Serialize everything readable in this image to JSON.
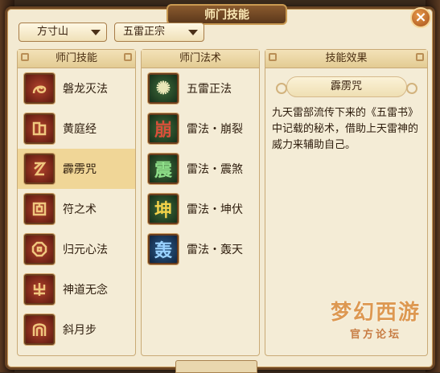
{
  "window": {
    "title": "师门技能",
    "close_label": "×"
  },
  "dropdowns": [
    {
      "value": "方寸山"
    },
    {
      "value": "五雷正宗"
    }
  ],
  "skills_panel": {
    "header": "师门技能",
    "items": [
      {
        "label": "磐龙灭法",
        "icon": "coiled-dragon-glyph"
      },
      {
        "label": "黄庭经",
        "icon": "scroll-book-glyph"
      },
      {
        "label": "霹雳咒",
        "icon": "lightning-glyph"
      },
      {
        "label": "符之术",
        "icon": "talisman-glyph"
      },
      {
        "label": "归元心法",
        "icon": "octagon-heart-glyph"
      },
      {
        "label": "神道无念",
        "icon": "trident-glyph"
      },
      {
        "label": "斜月步",
        "icon": "crescent-step-glyph"
      }
    ],
    "selected_index": 2
  },
  "spells_panel": {
    "header": "师门法术",
    "items": [
      {
        "label": "五雷正法",
        "icon": "thunder-seal-icon",
        "glyph": "✺"
      },
      {
        "label": "雷法・崩裂",
        "icon": "beng-rune-icon",
        "glyph": "崩"
      },
      {
        "label": "雷法・震煞",
        "icon": "zhen-rune-icon",
        "glyph": "震"
      },
      {
        "label": "雷法・坤伏",
        "icon": "kun-rune-icon",
        "glyph": "坤"
      },
      {
        "label": "雷法・轰天",
        "icon": "hong-rune-icon",
        "glyph": "轰"
      }
    ]
  },
  "effect_panel": {
    "header": "技能效果",
    "skill_name": "霹雳咒",
    "description": "九天雷部流传下来的《五雷书》中记载的秘术，借助上天雷神的威力来辅助自己。"
  },
  "watermark": {
    "line1": "梦幻西游",
    "line2": "官方论坛"
  },
  "colors": {
    "frame": "#6b4523",
    "panel_bg": "#f4ecd6",
    "selected_row": "#f0d697",
    "accent": "#d98a3a"
  }
}
